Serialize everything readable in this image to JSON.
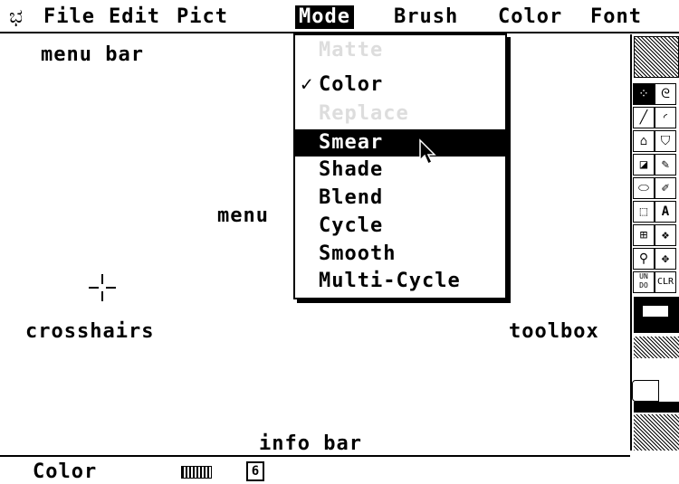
{
  "menubar": {
    "apple_glyph": "ಭ",
    "items": [
      "File",
      "Edit",
      "Pict",
      "Mode",
      "Brush",
      "Color",
      "Font"
    ],
    "active": "Mode"
  },
  "mode_menu": {
    "items": [
      {
        "label": "Matte",
        "state": "disabled"
      },
      {
        "label": "Color",
        "state": "checked"
      },
      {
        "label": "Replace",
        "state": "disabled"
      },
      {
        "label": "Smear",
        "state": "selected"
      },
      {
        "label": "Shade",
        "state": "normal"
      },
      {
        "label": "Blend",
        "state": "normal"
      },
      {
        "label": "Cycle",
        "state": "normal"
      },
      {
        "label": "Smooth",
        "state": "normal"
      },
      {
        "label": "Multi-Cycle",
        "state": "normal"
      }
    ],
    "check_glyph": "✓"
  },
  "annotations": {
    "menu_bar": "menu bar",
    "menu": "menu",
    "crosshairs": "crosshairs",
    "toolbox": "toolbox",
    "info_bar": "info bar"
  },
  "infobar": {
    "mode_text": "Color",
    "brush_size_glyph": "6"
  },
  "toolbox_labels": {
    "undo": "UN DO",
    "clr": "CLR",
    "text_tool": "A"
  }
}
